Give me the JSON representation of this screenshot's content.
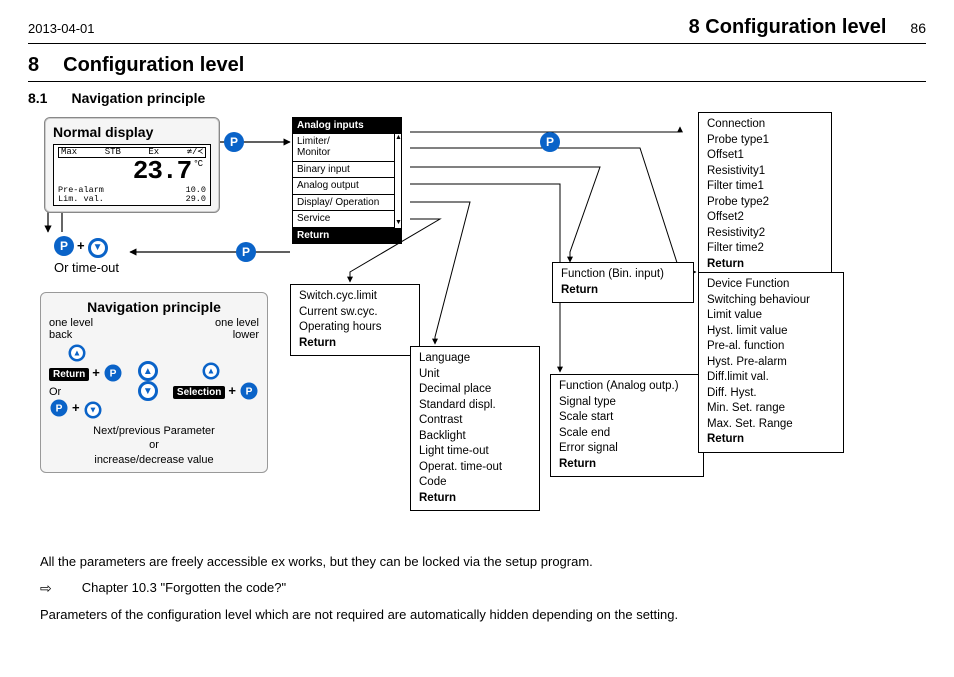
{
  "header": {
    "date": "2013-04-01",
    "chapter_title": "8 Configuration level",
    "page_number": "86"
  },
  "section": {
    "number": "8",
    "title": "Configuration level"
  },
  "subsection": {
    "number": "8.1",
    "title": "Navigation principle"
  },
  "diagram": {
    "normal_display": {
      "title": "Normal display",
      "lcd": {
        "top_left": "Max",
        "top_mid": "STB",
        "top_rt1": "Ex",
        "top_rt2": "≄/≺",
        "value": "23.7",
        "unit": "°C",
        "row1_l": "Pre-alarm",
        "row1_r": "10.0",
        "row2_l": "Lim. val.",
        "row2_r": "29.0"
      }
    },
    "p_button": "P",
    "or_timeout": "Or time-out",
    "nav_principle": {
      "title": "Navigation principle",
      "one_level_back": "one level\nback",
      "one_level_lower": "one level\nlower",
      "return_pill": "Return",
      "selection_pill": "Selection",
      "or": "Or",
      "caption1": "Next/previous Parameter",
      "caption_or": "or",
      "caption2": "increase/decrease value"
    },
    "menu": {
      "header": "Analog inputs",
      "items": [
        "Limiter/\nMonitor",
        "Binary input",
        "Analog output",
        "Display/ Operation",
        "Service"
      ],
      "footer": "Return"
    },
    "boxes": {
      "service": {
        "items": [
          "Switch.cyc.limit",
          "Current sw.cyc.",
          "Operating hours"
        ],
        "return": "Return"
      },
      "display": {
        "items": [
          "Language",
          "Unit",
          "Decimal place",
          "Standard displ.",
          "Contrast",
          "Backlight",
          "Light time-out",
          "Operat. time-out",
          "Code"
        ],
        "return": "Return"
      },
      "binary": {
        "items": [
          "Function (Bin. input)"
        ],
        "return": "Return"
      },
      "analog_out": {
        "items": [
          "Function (Analog outp.)",
          "Signal type",
          "Scale start",
          "Scale end",
          "Error signal"
        ],
        "return": "Return"
      },
      "analog_in": {
        "items": [
          "Connection",
          "Probe type1",
          "Offset1",
          "Resistivity1",
          "Filter time1",
          "Probe type2",
          "Offset2",
          "Resistivity2",
          "Filter time2"
        ],
        "return": "Return"
      },
      "limiter": {
        "items": [
          "Device Function",
          "Switching behaviour",
          "Limit value",
          "Hyst. limit value",
          "Pre-al. function",
          "Hyst. Pre-alarm",
          "Diff.limit val.",
          "Diff. Hyst.",
          "Min. Set. range",
          "Max. Set. Range"
        ],
        "return": "Return"
      }
    }
  },
  "body": {
    "p1": "All the parameters are freely accessible ex works, but they can be locked via the setup program.",
    "ref": "Chapter 10.3 \"Forgotten the code?\"",
    "ref_sym": "⇨",
    "p2": "Parameters of the configuration level which are not required are automatically hidden depending on the setting."
  }
}
